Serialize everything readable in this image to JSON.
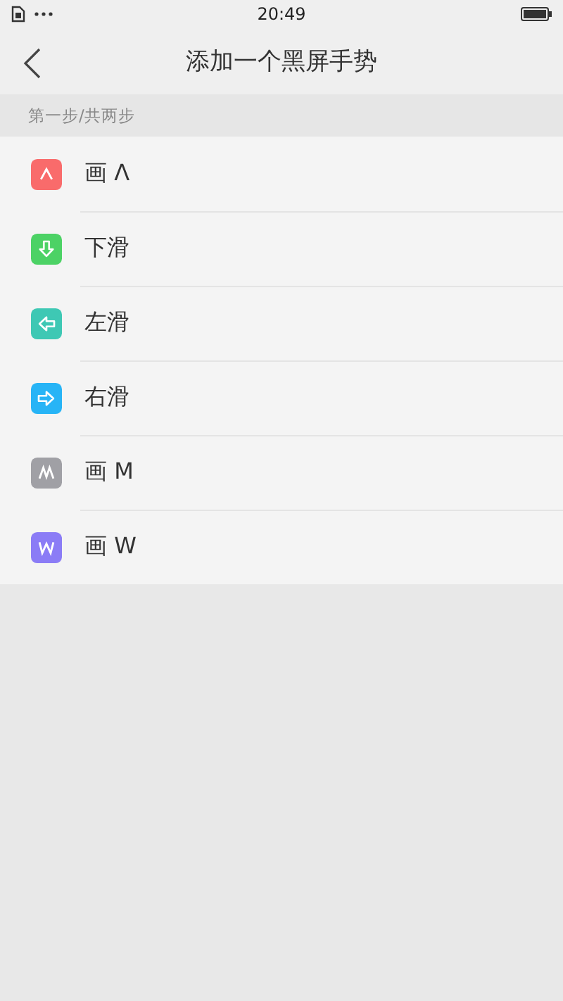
{
  "status_bar": {
    "time": "20:49"
  },
  "header": {
    "title": "添加一个黑屏手势"
  },
  "section": {
    "label": "第一步/共两步"
  },
  "gestures": [
    {
      "label": "画 Λ",
      "kind": "caret",
      "color": "#f96b6b"
    },
    {
      "label": "下滑",
      "kind": "down",
      "color": "#4cd265"
    },
    {
      "label": "左滑",
      "kind": "left",
      "color": "#3ec8b4"
    },
    {
      "label": "右滑",
      "kind": "right",
      "color": "#27b4f6"
    },
    {
      "label": "画 M",
      "kind": "m",
      "color": "#a0a0a5"
    },
    {
      "label": "画 W",
      "kind": "w",
      "color": "#8b7cf6"
    }
  ]
}
